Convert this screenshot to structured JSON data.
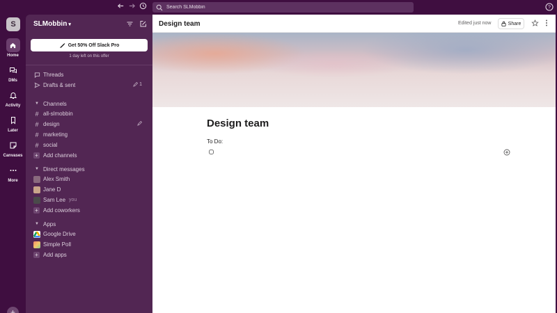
{
  "topbar": {
    "search_placeholder": "Search SLMobbin",
    "icons": [
      "arrow-left-icon",
      "arrow-right-icon",
      "history-icon",
      "search-icon",
      "help-icon"
    ]
  },
  "rail": {
    "workspace_initial": "S",
    "items": [
      {
        "label": "Home",
        "icon": "home-icon"
      },
      {
        "label": "DMs",
        "icon": "dms-icon"
      },
      {
        "label": "Activity",
        "icon": "bell-icon"
      },
      {
        "label": "Later",
        "icon": "bookmark-icon"
      },
      {
        "label": "Canvases",
        "icon": "canvas-icon"
      },
      {
        "label": "More",
        "icon": "more-icon"
      }
    ],
    "add_label": "+"
  },
  "sidebar": {
    "workspace_name": "SLMobbin",
    "promo_button": "Get 50% Off Slack Pro",
    "promo_sub": "1 day left on this offer",
    "threads": "Threads",
    "drafts": "Drafts & sent",
    "drafts_count": "1",
    "channels_header": "Channels",
    "channels": [
      "all-slmobbin",
      "design",
      "marketing",
      "social"
    ],
    "add_channels": "Add channels",
    "dm_header": "Direct messages",
    "dms": [
      {
        "name": "Alex Smith",
        "color": "#8a6a7e"
      },
      {
        "name": "Jane D",
        "color": "#c9a58a"
      },
      {
        "name": "Sam Lee",
        "color": "#4a4a4a"
      }
    ],
    "you_label": "you",
    "add_coworkers": "Add coworkers",
    "apps_header": "Apps",
    "apps": [
      {
        "name": "Google Drive"
      },
      {
        "name": "Simple Poll"
      }
    ],
    "add_apps": "Add apps"
  },
  "main": {
    "header_title": "Design team",
    "edited": "Edited just now",
    "share": "Share",
    "doc_title": "Design team",
    "todo": "To Do:"
  },
  "colors": {
    "aubergine": "#3f0e40",
    "sidebar": "#522653",
    "text": "#1d1c1d"
  }
}
